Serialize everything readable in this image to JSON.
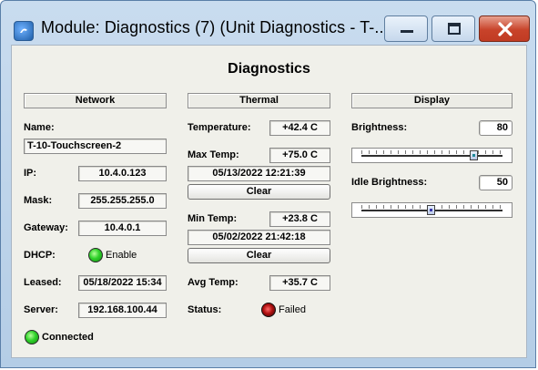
{
  "window": {
    "title": "Module: Diagnostics (7) (Unit Diagnostics - T-..."
  },
  "heading": "Diagnostics",
  "network": {
    "header": "Network",
    "name_label": "Name:",
    "name_value": "T-10-Touchscreen-2",
    "ip_label": "IP:",
    "ip_value": "10.4.0.123",
    "mask_label": "Mask:",
    "mask_value": "255.255.255.0",
    "gateway_label": "Gateway:",
    "gateway_value": "10.4.0.1",
    "dhcp_label": "DHCP:",
    "dhcp_value": "Enable",
    "leased_label": "Leased:",
    "leased_value": "05/18/2022 15:34",
    "server_label": "Server:",
    "server_value": "192.168.100.44",
    "connection_status": "Connected"
  },
  "thermal": {
    "header": "Thermal",
    "temperature_label": "Temperature:",
    "temperature_value": "+42.4 C",
    "max_temp_label": "Max Temp:",
    "max_temp_value": "+75.0 C",
    "max_temp_time": "05/13/2022 12:21:39",
    "clear_max_label": "Clear",
    "min_temp_label": "Min Temp:",
    "min_temp_value": "+23.8 C",
    "min_temp_time": "05/02/2022 21:42:18",
    "clear_min_label": "Clear",
    "avg_temp_label": "Avg Temp:",
    "avg_temp_value": "+35.7 C",
    "status_label": "Status:",
    "status_value": "Failed"
  },
  "display": {
    "header": "Display",
    "brightness_label": "Brightness:",
    "brightness_value": "80",
    "idle_brightness_label": "Idle Brightness:",
    "idle_brightness_value": "50"
  },
  "colors": {
    "led_ok": "#2fd12a",
    "led_failed": "#b01010",
    "close_button": "#c8432a"
  },
  "icons": {
    "app": "app-icon",
    "minimize": "minimize-icon",
    "maximize": "maximize-icon",
    "close": "close-icon"
  }
}
